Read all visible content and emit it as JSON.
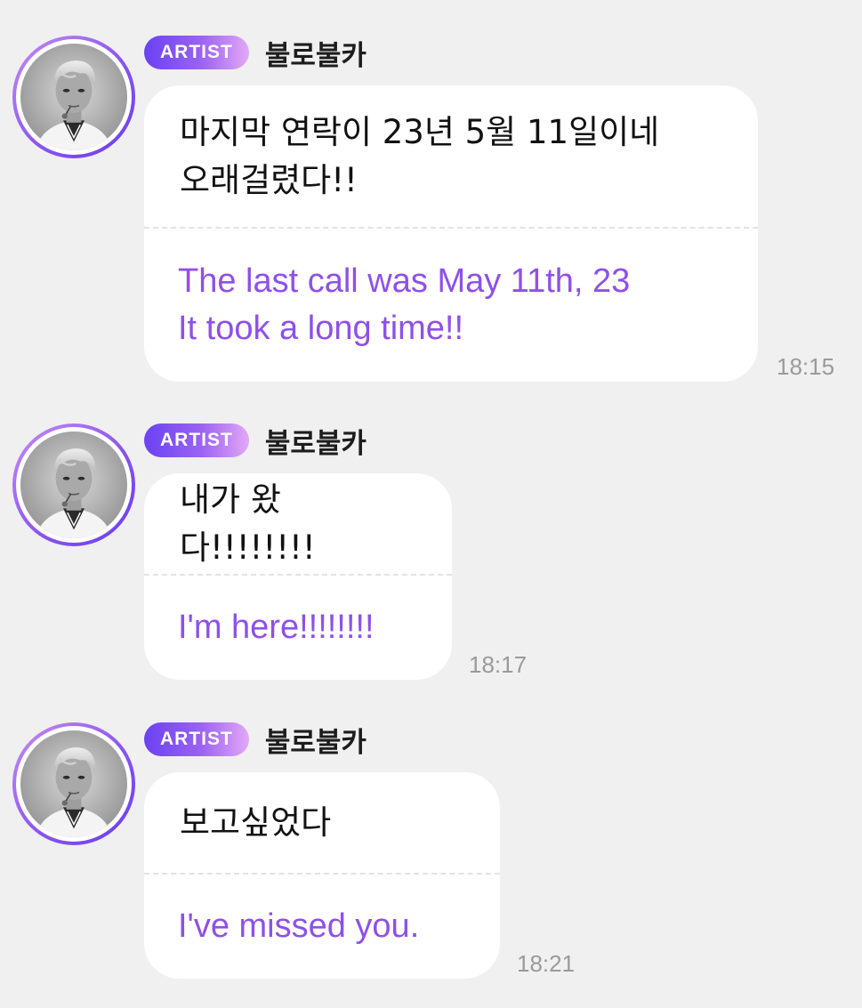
{
  "colors": {
    "background": "#f0f0f0",
    "bubble": "#ffffff",
    "translation_text": "#8e50e9",
    "badge_gradient_start": "#6a42f3",
    "badge_gradient_end": "#e3a8f6",
    "timestamp": "#9a9a9a"
  },
  "messages": [
    {
      "badge": "ARTIST",
      "sender": "불로불카",
      "text": "마지막 연락이 23년 5월 11일이네\n오래걸렸다!!",
      "translation": "The last call was May 11th, 23\nIt took a long time!!",
      "time": "18:15",
      "avatar_icon": "profile-photo-icon"
    },
    {
      "badge": "ARTIST",
      "sender": "불로불카",
      "text": "내가 왔다!!!!!!!!",
      "translation": "I'm here!!!!!!!!",
      "time": "18:17",
      "avatar_icon": "profile-photo-icon"
    },
    {
      "badge": "ARTIST",
      "sender": "불로불카",
      "text": "보고싶었다",
      "translation": "I've missed you.",
      "time": "18:21",
      "avatar_icon": "profile-photo-icon"
    }
  ]
}
